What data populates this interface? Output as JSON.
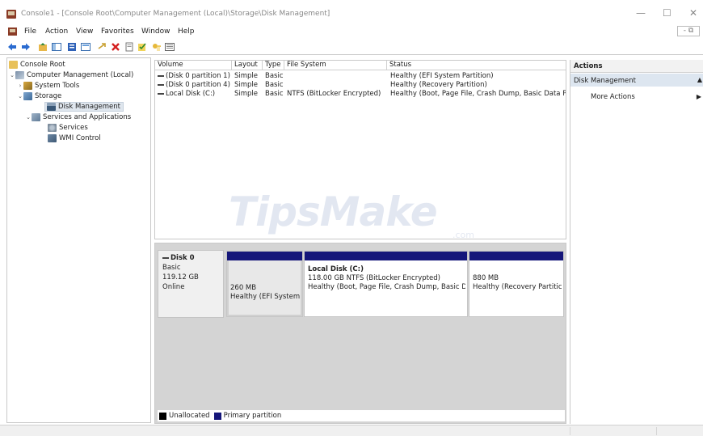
{
  "window": {
    "title": "Console1 - [Console Root\\Computer Management (Local)\\Storage\\Disk Management]",
    "minimize": "—",
    "maximize": "☐",
    "close": "✕",
    "mdi_controls": "- ⧉"
  },
  "menubar": {
    "items": [
      "File",
      "Action",
      "View",
      "Favorites",
      "Window",
      "Help"
    ]
  },
  "toolbar": {
    "icons": [
      "back-arrow-icon",
      "forward-arrow-icon",
      "up-folder-icon",
      "show-tree-icon",
      "properties-icon",
      "help-icon",
      "connect-icon",
      "delete-icon",
      "export-icon",
      "check-icon",
      "key-icon",
      "list-view-icon"
    ]
  },
  "tree": {
    "root": "Console Root",
    "computer_management": "Computer Management (Local)",
    "system_tools": "System Tools",
    "storage": "Storage",
    "disk_management": "Disk Management",
    "services_apps": "Services and Applications",
    "services": "Services",
    "wmi": "WMI Control"
  },
  "volumes": {
    "headers": [
      "Volume",
      "Layout",
      "Type",
      "File System",
      "Status"
    ],
    "rows": [
      {
        "volume": "(Disk 0 partition 1)",
        "layout": "Simple",
        "type": "Basic",
        "fs": "",
        "status": "Healthy (EFI System Partition)"
      },
      {
        "volume": "(Disk 0 partition 4)",
        "layout": "Simple",
        "type": "Basic",
        "fs": "",
        "status": "Healthy (Recovery Partition)"
      },
      {
        "volume": "Local Disk (C:)",
        "layout": "Simple",
        "type": "Basic",
        "fs": "NTFS (BitLocker Encrypted)",
        "status": "Healthy (Boot, Page File, Crash Dump, Basic Data Pa"
      }
    ],
    "scroll_left": "‹",
    "scroll_right": "›"
  },
  "disk": {
    "name": "Disk 0",
    "type": "Basic",
    "size": "119.12 GB",
    "state": "Online",
    "partitions": [
      {
        "title": "",
        "size": "260 MB",
        "status": "Healthy (EFI System"
      },
      {
        "title": "Local Disk  (C:)",
        "size": "118.00 GB NTFS (BitLocker Encrypted)",
        "status": "Healthy (Boot, Page File, Crash Dump, Basic D"
      },
      {
        "title": "",
        "size": "880 MB",
        "status": "Healthy (Recovery Partitic"
      }
    ]
  },
  "legend": {
    "unallocated": "Unallocated",
    "primary": "Primary partition",
    "unallocated_color": "#000000",
    "primary_color": "#15167a"
  },
  "actions": {
    "header": "Actions",
    "section": "Disk Management",
    "more": "More Actions",
    "section_arrow": "▲",
    "more_arrow": "▶"
  },
  "watermark": {
    "text": "TipsMake",
    "suffix": ".com"
  }
}
